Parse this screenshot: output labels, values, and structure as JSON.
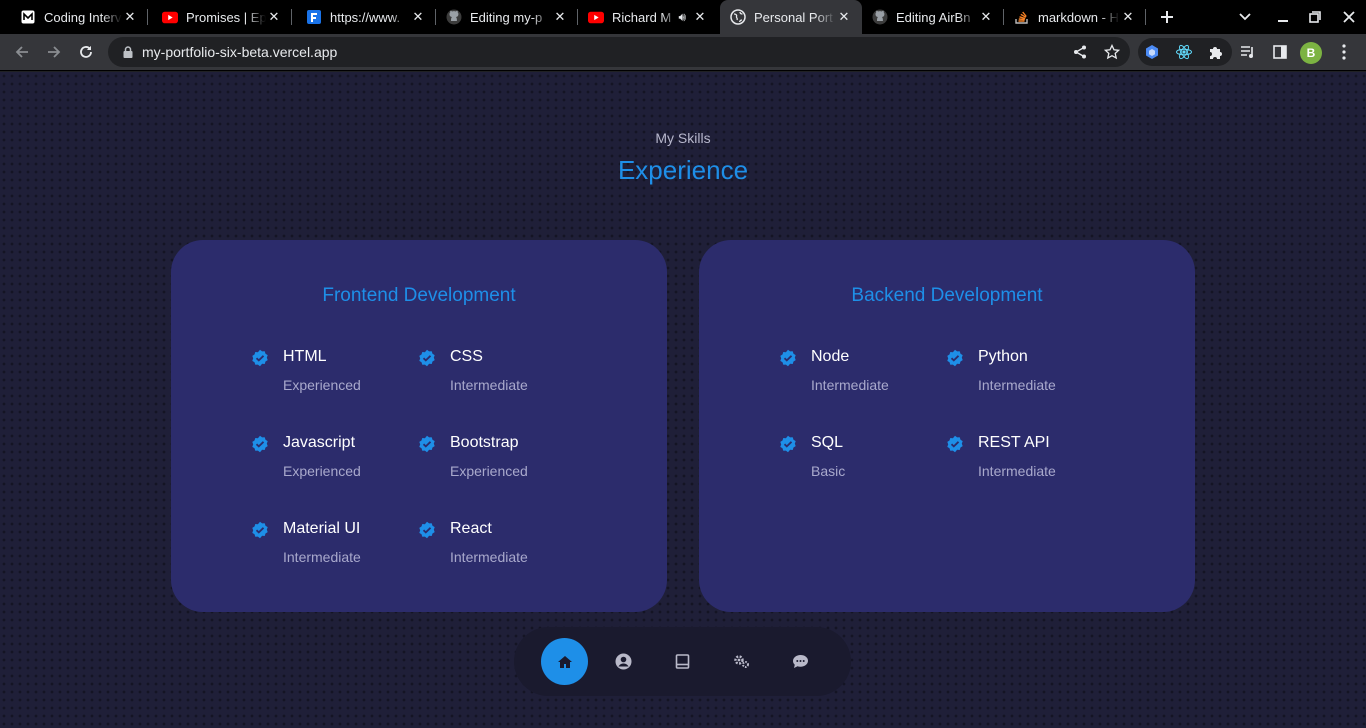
{
  "browser": {
    "tabs": [
      {
        "title": "Coding Interv",
        "icon": "coding-interview-favicon"
      },
      {
        "title": "Promises | Ep",
        "icon": "youtube-favicon"
      },
      {
        "title": "https://www.",
        "icon": "f-favicon"
      },
      {
        "title": "Editing my-p",
        "icon": "github-favicon"
      },
      {
        "title": "Richard M",
        "icon": "youtube-favicon"
      },
      {
        "title": "Personal Port",
        "icon": "globe-favicon"
      },
      {
        "title": "Editing AirBn",
        "icon": "github-favicon"
      },
      {
        "title": "markdown - H",
        "icon": "stackoverflow-favicon"
      }
    ],
    "url": "my-portfolio-six-beta.vercel.app",
    "profile_initial": "B"
  },
  "page": {
    "subheading": "My Skills",
    "heading": "Experience",
    "cards": [
      {
        "title": "Frontend Development",
        "skills": [
          {
            "name": "HTML",
            "level": "Experienced"
          },
          {
            "name": "CSS",
            "level": "Intermediate"
          },
          {
            "name": "Javascript",
            "level": "Experienced"
          },
          {
            "name": "Bootstrap",
            "level": "Experienced"
          },
          {
            "name": "Material UI",
            "level": "Intermediate"
          },
          {
            "name": "React",
            "level": "Intermediate"
          }
        ]
      },
      {
        "title": "Backend Development",
        "skills": [
          {
            "name": "Node",
            "level": "Intermediate"
          },
          {
            "name": "Python",
            "level": "Intermediate"
          },
          {
            "name": "SQL",
            "level": "Basic"
          },
          {
            "name": "REST API",
            "level": "Intermediate"
          }
        ]
      }
    ],
    "bottom_nav": [
      {
        "icon": "home-icon",
        "active": true
      },
      {
        "icon": "user-icon",
        "active": false
      },
      {
        "icon": "book-icon",
        "active": false
      },
      {
        "icon": "gears-icon",
        "active": false
      },
      {
        "icon": "chat-icon",
        "active": false
      }
    ]
  },
  "colors": {
    "accent": "#1e8fe8",
    "card_bg": "#2c2c6c",
    "page_bg": "#1f1f38"
  }
}
